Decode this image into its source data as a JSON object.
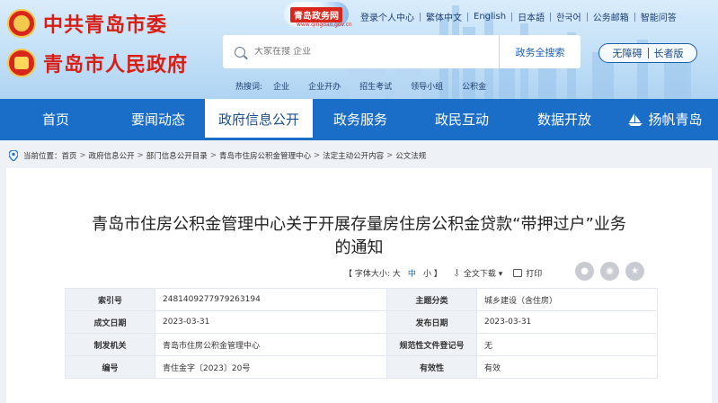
{
  "header": {
    "party_title": "中共青岛市委",
    "gov_title": "青岛市人民政府",
    "brand_badge": "青岛政务网",
    "brand_url": "www.qingdao.gov.cn",
    "top_links": [
      "登录个人中心",
      "繁体中文",
      "English",
      "日本語",
      "한국어",
      "公务邮箱",
      "智能问答"
    ],
    "search": {
      "placeholder": "大家在搜 企业",
      "button": "政务全搜索"
    },
    "hotwords_label": "热搜词:",
    "hotwords": [
      "企业",
      "企业开办",
      "招生考试",
      "领导小组",
      "公积金"
    ],
    "accessibility": {
      "barrier_free": "无障碍",
      "elder": "长者版"
    }
  },
  "nav": {
    "items": [
      "首页",
      "要闻动态",
      "政府信息公开",
      "政务服务",
      "政民互动",
      "数据开放",
      "扬帆青岛"
    ],
    "active_index": 2
  },
  "breadcrumb": {
    "label": "当前位置：",
    "parts": [
      "首页",
      "政府信息公开",
      "部门信息公开目录",
      "青岛市住房公积金管理中心",
      "法定主动公开内容",
      "公文法规"
    ]
  },
  "article": {
    "title_line1": "青岛市住房公积金管理中心关于开展存量房住房公积金贷款“带押过户”业务",
    "title_line2": "的通知",
    "font_size_label": "【 字体大小:",
    "size_large": "大",
    "size_medium": "中",
    "size_small": "小 】",
    "download": "全文下载",
    "print": "打印",
    "meta": [
      {
        "k1": "索引号",
        "v1": "2481409277979263194",
        "k2": "主题分类",
        "v2": "城乡建设（含住房）"
      },
      {
        "k1": "成文日期",
        "v1": "2023-03-31",
        "k2": "发布日期",
        "v2": "2023-03-31"
      },
      {
        "k1": "制发机关",
        "v1": "青岛市住房公积金管理中心",
        "k2": "规范性文件登记号",
        "v2": "无"
      },
      {
        "k1": "编号",
        "v1": "青住金字〔2023〕20号",
        "k2": "有效性",
        "v2": "有效"
      }
    ]
  },
  "colors": {
    "nav_blue": "#1b6ec7",
    "title_red": "#d81e14",
    "link_blue": "#1b5fae"
  }
}
